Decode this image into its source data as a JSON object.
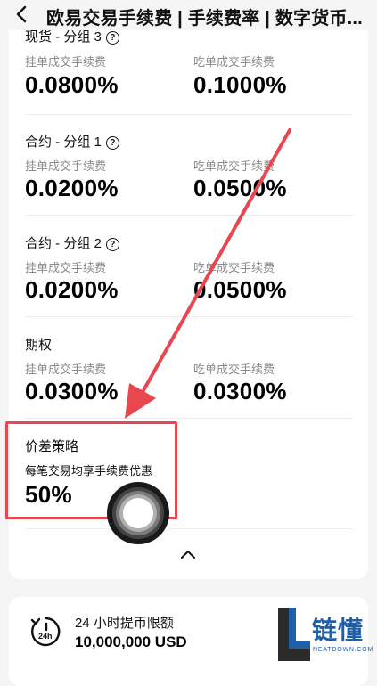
{
  "header": {
    "back_icon": "chevron-left-icon",
    "title": "欧易交易手续费 | 手续费率 | 数字货币..."
  },
  "fee_groups": [
    {
      "title": "现货 - 分组 3",
      "has_help": true,
      "maker_label": "挂单成交手续费",
      "maker_value": "0.0800%",
      "taker_label": "吃单成交手续费",
      "taker_value": "0.1000%"
    },
    {
      "title": "合约 - 分组 1",
      "has_help": true,
      "maker_label": "挂单成交手续费",
      "maker_value": "0.0200%",
      "taker_label": "吃单成交手续费",
      "taker_value": "0.0500%"
    },
    {
      "title": "合约 - 分组 2",
      "has_help": true,
      "maker_label": "挂单成交手续费",
      "maker_value": "0.0200%",
      "taker_label": "吃单成交手续费",
      "taker_value": "0.0500%"
    },
    {
      "title": "期权",
      "has_help": false,
      "maker_label": "挂单成交手续费",
      "maker_value": "0.0300%",
      "taker_label": "吃单成交手续费",
      "taker_value": "0.0300%"
    }
  ],
  "spread_strategy": {
    "title": "价差策略",
    "subtitle": "每笔交易均享手续费优惠",
    "value": "50%"
  },
  "collapse": {
    "icon": "chevron-up-icon"
  },
  "withdrawal": {
    "icon": "24h-clock-icon",
    "icon_text": "24h",
    "label": "24 小时提币限额",
    "value": "10,000,000 USD"
  },
  "watermark": {
    "brand": "链懂",
    "url": "NEATDOWN.COM"
  },
  "annotation": {
    "color": "#e8474f"
  }
}
